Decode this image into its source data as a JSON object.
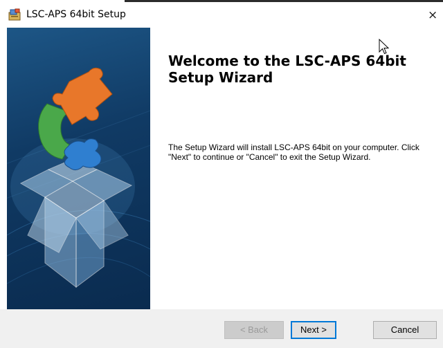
{
  "window": {
    "title": "LSC-APS 64bit Setup",
    "close_glyph": "×",
    "icons": [
      "installer-icon",
      "close-icon",
      "mouse-pointer-icon"
    ]
  },
  "banner": {
    "image": "puzzle-piece-box-illustration",
    "colors": {
      "background": "#103a64",
      "puzzle_orange": "#e8772a",
      "puzzle_green": "#4aa84a",
      "puzzle_blue": "#2f7fd0"
    }
  },
  "content": {
    "heading": "Welcome to the LSC-APS 64bit Setup Wizard",
    "description": "The Setup Wizard will install LSC-APS 64bit on your computer.  Click \"Next\" to continue or \"Cancel\" to exit the Setup Wizard."
  },
  "buttons": {
    "back": "< Back",
    "next": "Next >",
    "cancel": "Cancel",
    "back_enabled": false,
    "default_button": "next",
    "focus_color": "#0078d7"
  }
}
